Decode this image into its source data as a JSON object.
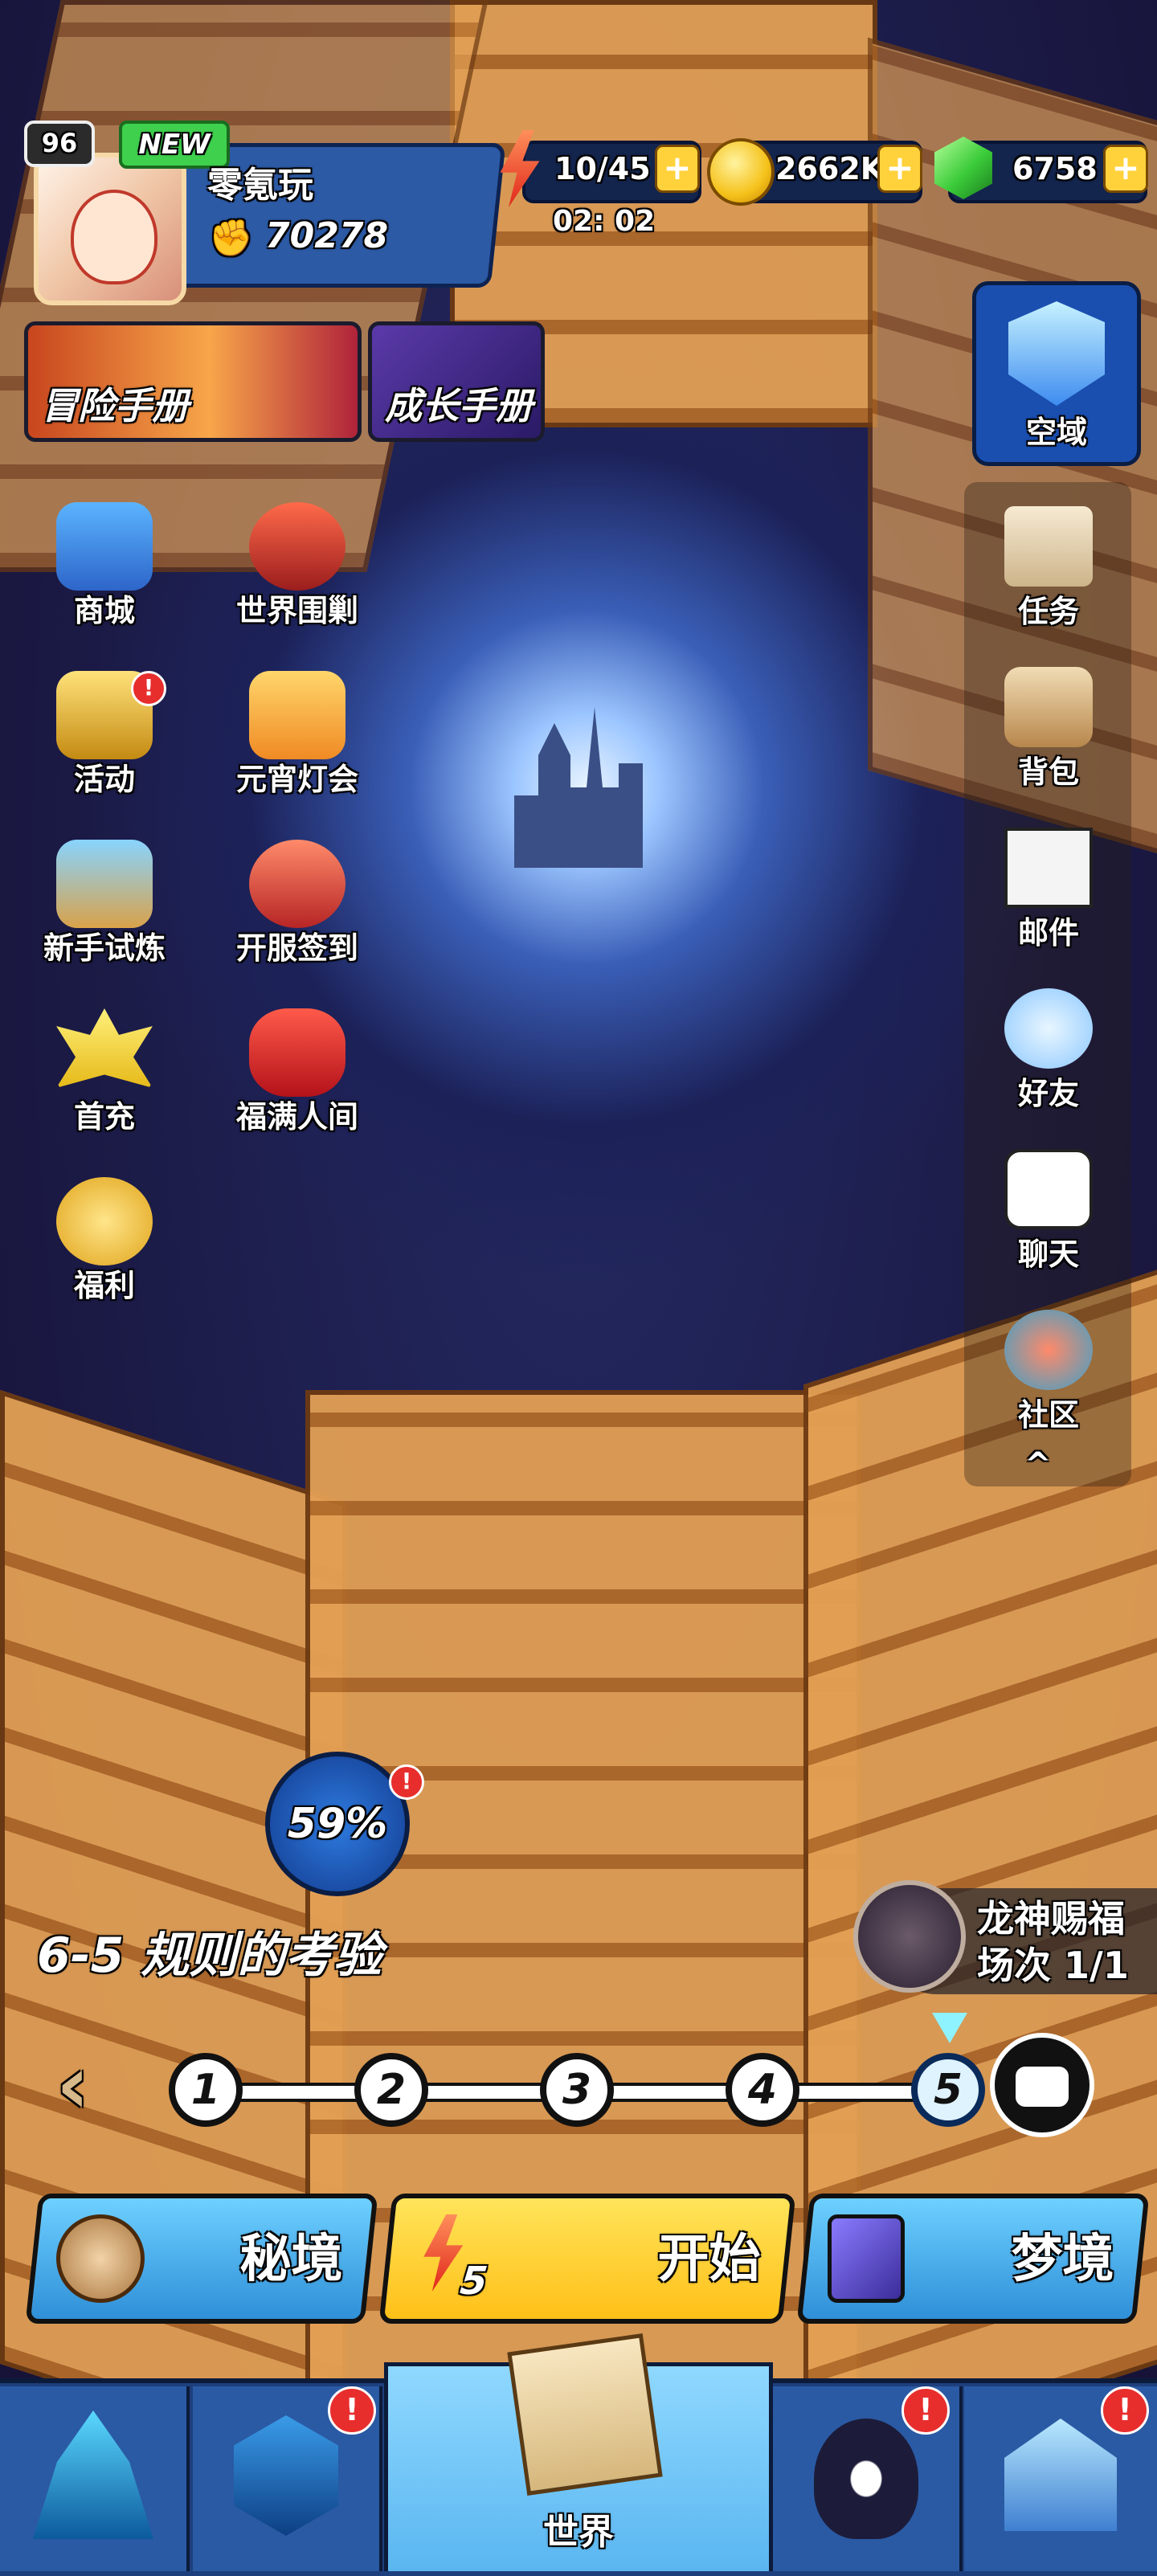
{
  "player": {
    "level": "96",
    "new_tag": "NEW",
    "name": "零氪玩",
    "power": "70278"
  },
  "resources": {
    "energy": "10/45",
    "energy_timer": "02: 02",
    "gold": "2662K",
    "gems": "6758",
    "plus": "+"
  },
  "banners": {
    "adventure": "冒险手册",
    "growth": "成长手册"
  },
  "domain_button": "空域",
  "left_icons": [
    {
      "label": "商城"
    },
    {
      "label": "世界围剿"
    },
    {
      "label": "活动",
      "badge": "!"
    },
    {
      "label": "元宵灯会"
    },
    {
      "label": "新手试炼"
    },
    {
      "label": "开服签到"
    },
    {
      "label": "首充"
    },
    {
      "label": "福满人间"
    },
    {
      "label": "福利"
    }
  ],
  "right_icons": [
    {
      "label": "任务"
    },
    {
      "label": "背包"
    },
    {
      "label": "邮件"
    },
    {
      "label": "好友"
    },
    {
      "label": "聊天"
    },
    {
      "label": "社区"
    }
  ],
  "collapse_arrow": "^",
  "progress": {
    "percent": "59%",
    "badge": "!"
  },
  "chapter": {
    "title": "6-5 规则的考验"
  },
  "dragon_blessing": {
    "title": "龙神赐福",
    "count": "场次 1/1"
  },
  "stages": [
    "1",
    "2",
    "3",
    "4",
    "5"
  ],
  "nav_arrow": "‹",
  "actions": {
    "secret": "秘境",
    "start": "开始",
    "start_cost": "5",
    "dream": "梦境"
  },
  "tabs": {
    "world": "世界",
    "badge": "!"
  },
  "colors": {
    "blue_button": "#3aa9e8",
    "yellow_button": "#ffd02a",
    "badge_red": "#e82d2d"
  }
}
